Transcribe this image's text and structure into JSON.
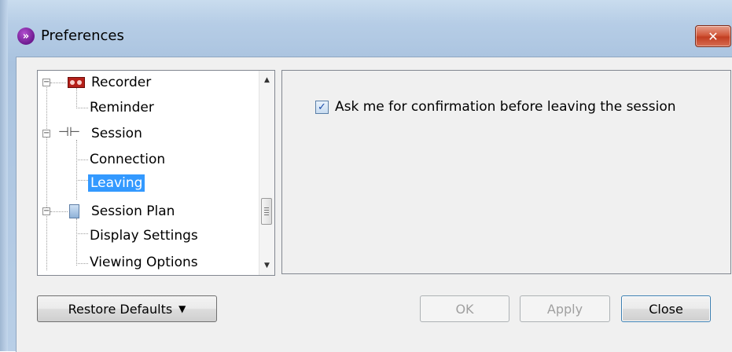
{
  "window": {
    "title": "Preferences",
    "close_glyph": "✕",
    "app_icon_glyph": "»"
  },
  "tree": {
    "items": [
      {
        "label": "Recorder",
        "icon": "recorder-icon",
        "expanded": true
      },
      {
        "label": "Reminder"
      },
      {
        "label": "Session",
        "icon": "plug-icon",
        "expanded": true
      },
      {
        "label": "Connection"
      },
      {
        "label": "Leaving",
        "selected": true
      },
      {
        "label": "Session Plan",
        "icon": "document-icon",
        "expanded": true
      },
      {
        "label": "Display Settings"
      },
      {
        "label": "Viewing Options"
      }
    ]
  },
  "content": {
    "checkbox_label": "Ask me for confirmation before leaving the session",
    "checkbox_checked": true
  },
  "buttons": {
    "restore": "Restore Defaults",
    "ok": "OK",
    "apply": "Apply",
    "close": "Close"
  },
  "colors": {
    "selection": "#3399ff",
    "close_button": "#c8452a"
  }
}
